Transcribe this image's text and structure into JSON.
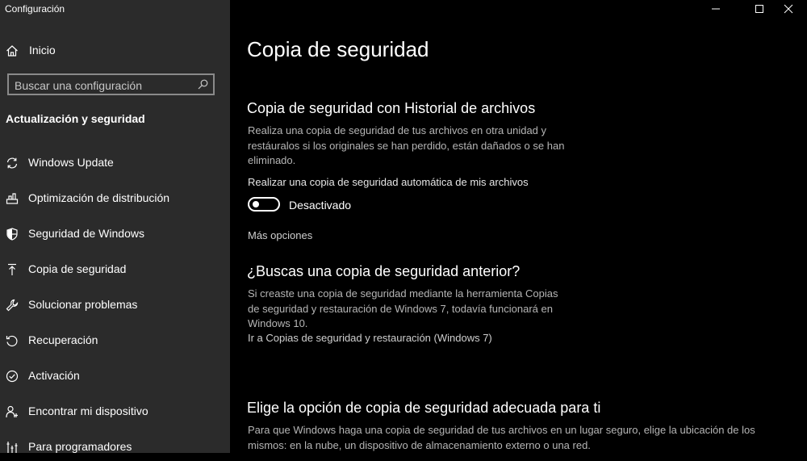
{
  "app": {
    "title": "Configuración"
  },
  "sidebar": {
    "home_label": "Inicio",
    "search_placeholder": "Buscar una configuración",
    "section_title": "Actualización y seguridad",
    "items": [
      {
        "label": "Windows Update",
        "icon": "sync-icon"
      },
      {
        "label": "Optimización de distribución",
        "icon": "delivery-optimization-icon"
      },
      {
        "label": "Seguridad de Windows",
        "icon": "shield-icon"
      },
      {
        "label": "Copia de seguridad",
        "icon": "backup-upload-icon"
      },
      {
        "label": "Solucionar problemas",
        "icon": "wrench-icon"
      },
      {
        "label": "Recuperación",
        "icon": "recovery-icon"
      },
      {
        "label": "Activación",
        "icon": "check-circle-icon"
      },
      {
        "label": "Encontrar mi dispositivo",
        "icon": "person-location-icon"
      },
      {
        "label": "Para programadores",
        "icon": "developer-tools-icon"
      }
    ]
  },
  "main": {
    "page_title": "Copia de seguridad",
    "file_history": {
      "heading": "Copia de seguridad con Historial de archivos",
      "description_lines": [
        "Realiza una copia de seguridad de tus archivos en otra unidad y",
        "restáuralos si los originales se han perdido, están dañados o se han",
        "eliminado."
      ],
      "auto_backup_label": "Realizar una copia de seguridad automática de mis archivos",
      "toggle_state": "Desactivado",
      "toggle_on": false,
      "more_options": "Más opciones"
    },
    "older_backup": {
      "heading": "¿Buscas una copia de seguridad anterior?",
      "description_lines": [
        "Si creaste una copia de seguridad mediante la herramienta Copias",
        "de seguridad y restauración de Windows 7, todavía funcionará en",
        "Windows 10."
      ],
      "link": "Ir a Copias de seguridad y restauración (Windows 7)"
    },
    "choose_option": {
      "heading": "Elige la opción de copia de seguridad adecuada para ti",
      "description_lines": [
        "Para que Windows haga una copia de seguridad de tus archivos en un lugar seguro, elige la ubicación de los",
        "mismos: en la nube, un dispositivo de almacenamiento externo o una red."
      ]
    }
  }
}
